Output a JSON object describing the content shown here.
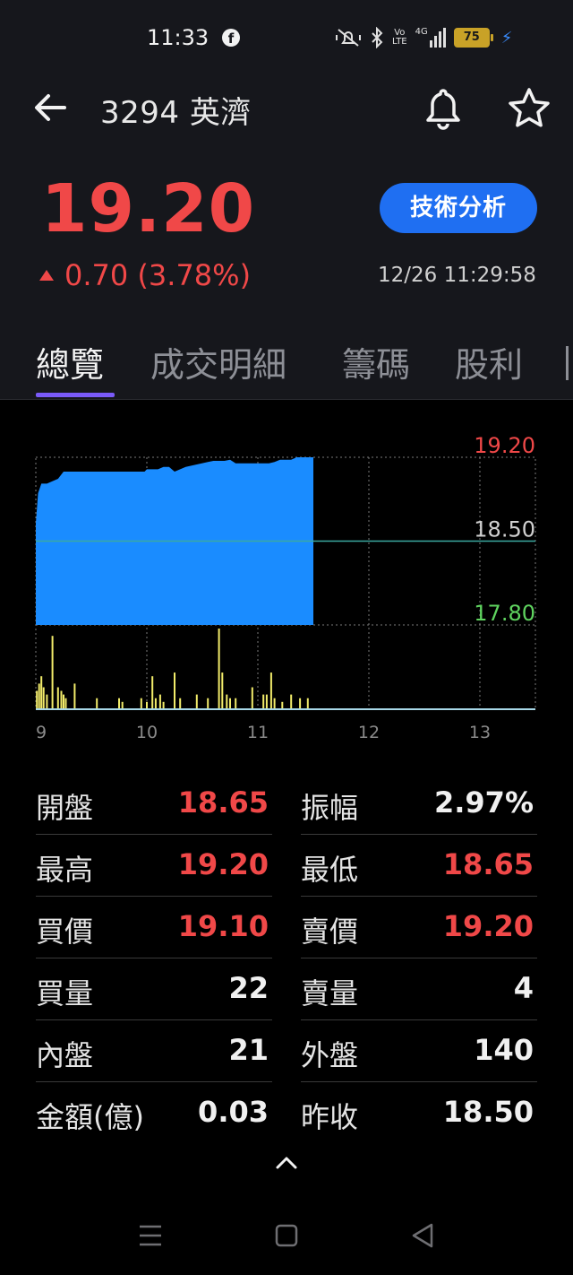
{
  "status_bar": {
    "time": "11:33",
    "fb": "f",
    "volte_top": "Vo",
    "volte_bottom": "LTE",
    "network": "4G",
    "battery": "75"
  },
  "header": {
    "title": "3294 英濟",
    "price": "19.20",
    "change": "0.70 (3.78%)",
    "technical_analysis_label": "技術分析",
    "timestamp": "12/26 11:29:58"
  },
  "tabs": [
    {
      "label": "總覽",
      "active": true
    },
    {
      "label": "成交明細",
      "active": false
    },
    {
      "label": "籌碼",
      "active": false
    },
    {
      "label": "股利",
      "active": false
    }
  ],
  "colors": {
    "up": "#f04848",
    "down": "#5fd35f",
    "area": "#1a8cff",
    "volume": "#f2ec6a",
    "accent": "#7a5af8",
    "button": "#1f6ff2"
  },
  "chart_data": {
    "type": "area",
    "y_labels": {
      "high": "19.20",
      "ref": "18.50",
      "low": "17.80"
    },
    "ylim": [
      17.8,
      19.2
    ],
    "reference": 18.5,
    "x_ticks": [
      "9",
      "10",
      "11",
      "12",
      "13"
    ],
    "xlim": [
      9,
      13.5
    ],
    "price": {
      "x": [
        9.0,
        9.02,
        9.05,
        9.1,
        9.2,
        9.25,
        9.5,
        9.75,
        9.98,
        10.0,
        10.05,
        10.1,
        10.15,
        10.2,
        10.25,
        10.3,
        10.35,
        10.45,
        10.55,
        10.6,
        10.7,
        10.75,
        10.8,
        10.9,
        11.0,
        11.1,
        11.15,
        11.2,
        11.3,
        11.35,
        11.42,
        11.5
      ],
      "y": [
        18.65,
        18.9,
        18.98,
        18.98,
        19.02,
        19.08,
        19.08,
        19.08,
        19.08,
        19.1,
        19.1,
        19.1,
        19.12,
        19.12,
        19.08,
        19.1,
        19.12,
        19.14,
        19.16,
        19.17,
        19.17,
        19.18,
        19.15,
        19.15,
        19.15,
        19.15,
        19.16,
        19.18,
        19.18,
        19.2,
        19.2,
        19.2
      ]
    },
    "volume": {
      "x": [
        9.01,
        9.03,
        9.05,
        9.07,
        9.1,
        9.15,
        9.2,
        9.23,
        9.25,
        9.27,
        9.35,
        9.55,
        9.75,
        9.78,
        9.95,
        10.0,
        10.05,
        10.08,
        10.12,
        10.15,
        10.25,
        10.3,
        10.45,
        10.55,
        10.65,
        10.68,
        10.72,
        10.75,
        10.8,
        10.95,
        11.05,
        11.08,
        11.12,
        11.15,
        11.22,
        11.3,
        11.38,
        11.45
      ],
      "y": [
        5,
        7,
        9,
        6,
        4,
        20,
        6,
        5,
        4,
        3,
        7,
        3,
        3,
        2,
        3,
        2,
        9,
        3,
        4,
        2,
        10,
        3,
        4,
        3,
        22,
        10,
        4,
        3,
        3,
        6,
        4,
        4,
        10,
        3,
        2,
        4,
        3,
        3
      ]
    }
  },
  "stats": [
    {
      "left": {
        "label": "開盤",
        "value": "18.65",
        "color": "red"
      },
      "right": {
        "label": "振幅",
        "value": "2.97%",
        "color": "white"
      }
    },
    {
      "left": {
        "label": "最高",
        "value": "19.20",
        "color": "red"
      },
      "right": {
        "label": "最低",
        "value": "18.65",
        "color": "red"
      }
    },
    {
      "left": {
        "label": "買價",
        "value": "19.10",
        "color": "red"
      },
      "right": {
        "label": "賣價",
        "value": "19.20",
        "color": "red"
      }
    },
    {
      "left": {
        "label": "買量",
        "value": "22",
        "color": "white"
      },
      "right": {
        "label": "賣量",
        "value": "4",
        "color": "white"
      }
    },
    {
      "left": {
        "label": "內盤",
        "value": "21",
        "color": "white"
      },
      "right": {
        "label": "外盤",
        "value": "140",
        "color": "white"
      }
    },
    {
      "left": {
        "label": "金額(億)",
        "value": "0.03",
        "color": "white"
      },
      "right": {
        "label": "昨收",
        "value": "18.50",
        "color": "white"
      }
    }
  ]
}
